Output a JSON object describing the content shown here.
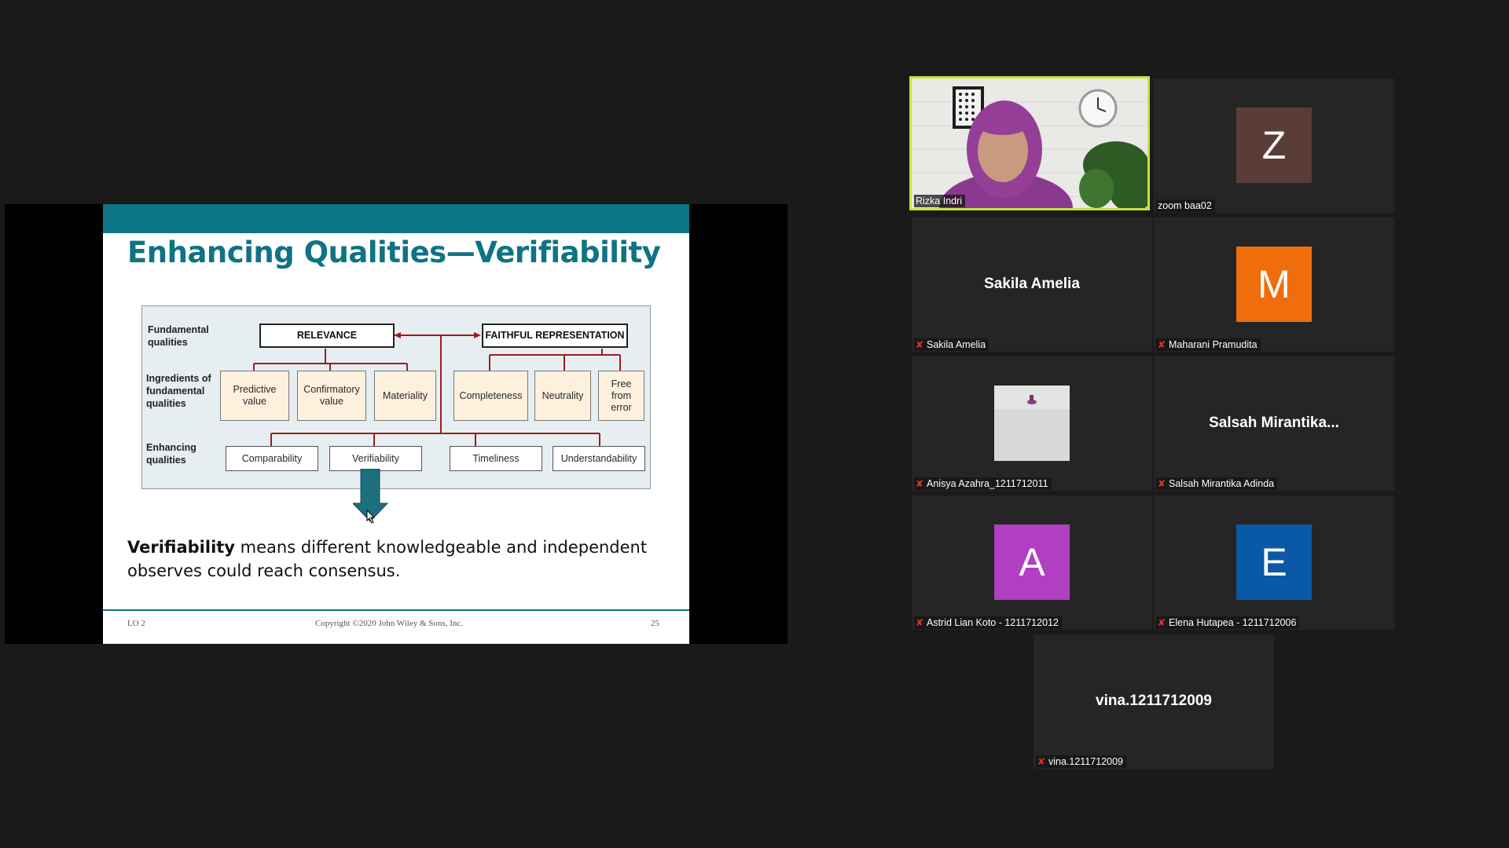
{
  "slide": {
    "title": "Enhancing Qualities—Verifiability",
    "row_labels": {
      "fundamental": "Fundamental\nqualities",
      "ingredients": "Ingredients of\nfundamental\nqualities",
      "enhancing": "Enhancing\nqualities"
    },
    "top_boxes": {
      "relevance": "RELEVANCE",
      "faithful": "FAITHFUL REPRESENTATION"
    },
    "ingredients": {
      "predictive": "Predictive\nvalue",
      "confirmatory": "Confirmatory\nvalue",
      "materiality": "Materiality",
      "completeness": "Completeness",
      "neutrality": "Neutrality",
      "free_from_error": "Free\nfrom\nerror"
    },
    "enhancing": {
      "comparability": "Comparability",
      "verifiability": "Verifiability",
      "timeliness": "Timeliness",
      "understandability": "Understandability"
    },
    "body_bold": "Verifiability",
    "body_rest": " means different knowledgeable and independent observes could reach consensus.",
    "footer": {
      "left": "LO 2",
      "center": "Copyright ©2020 John Wiley & Sons, Inc.",
      "right": "25"
    },
    "colors": {
      "bar": "#0d7687",
      "lines": "#9c1c22",
      "arrow": "#1d6f7e"
    }
  },
  "participants": [
    {
      "name": "Rizka Indri",
      "type": "video",
      "muted": false,
      "active": true
    },
    {
      "name": "zoom baa02",
      "type": "avatar",
      "initial": "Z",
      "color": "#5b3d37",
      "muted": false
    },
    {
      "name": "Sakila Amelia",
      "type": "name",
      "display": "Sakila Amelia",
      "muted": true
    },
    {
      "name": "Maharani Pramudita",
      "type": "avatar",
      "initial": "M",
      "color": "#f06d0c",
      "muted": true
    },
    {
      "name": "Anisya Azahra_1211712011",
      "type": "photo",
      "muted": true
    },
    {
      "name": "Salsah Mirantika Adinda",
      "type": "name",
      "display": "Salsah  Mirantika...",
      "muted": true
    },
    {
      "name": "Astrid Lian Koto - 1211712012",
      "type": "avatar",
      "initial": "A",
      "color": "#b03fc1",
      "muted": true
    },
    {
      "name": "Elena Hutapea - 1211712006",
      "type": "avatar",
      "initial": "E",
      "color": "#0a59a7",
      "muted": true
    },
    {
      "name": "vina.1211712009",
      "type": "name",
      "display": "vina.1211712009",
      "muted": true
    }
  ],
  "icons": {
    "muted": "mic-muted-icon",
    "cursor": "mouse-pointer-icon"
  }
}
